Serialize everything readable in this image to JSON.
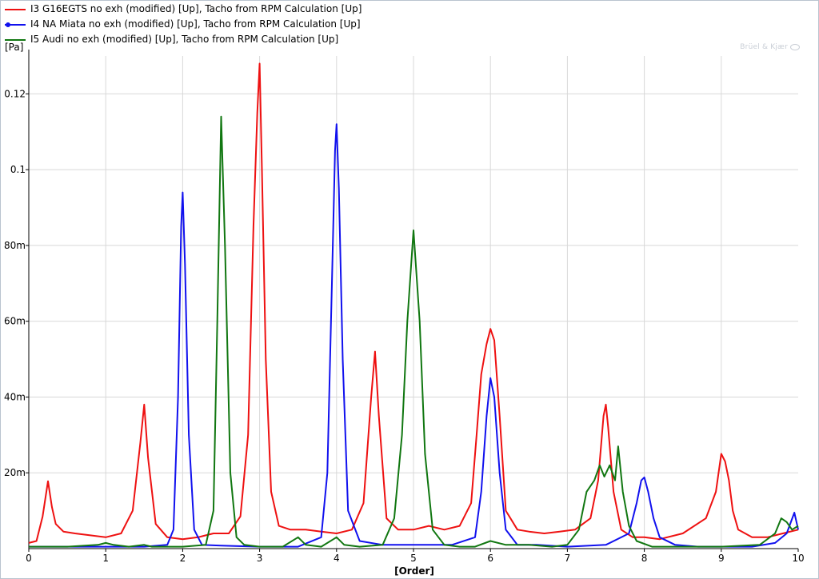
{
  "legend": {
    "items": [
      {
        "label": "I3 G16EGTS no exh (modified) [Up], Tacho from RPM Calculation [Up]",
        "color": "#ee1111",
        "marker": false
      },
      {
        "label": "I4 NA Miata no exh (modified) [Up], Tacho from RPM Calculation [Up]",
        "color": "#1111ee",
        "marker": true
      },
      {
        "label": "I5 Audi no exh (modified) [Up], Tacho from RPM Calculation [Up]",
        "color": "#117711",
        "marker": false
      }
    ]
  },
  "brand": "Brüel & Kjær",
  "chart_data": {
    "type": "line",
    "title": "",
    "xlabel": "[Order]",
    "ylabel": "[Pa]",
    "xlim": [
      0,
      10
    ],
    "ylim": [
      0,
      0.13
    ],
    "grid": true,
    "legend_position": "top-left",
    "x_ticks": [
      {
        "value": 0,
        "label": "0"
      },
      {
        "value": 1,
        "label": "1"
      },
      {
        "value": 2,
        "label": "2"
      },
      {
        "value": 3,
        "label": "3"
      },
      {
        "value": 4,
        "label": "4"
      },
      {
        "value": 5,
        "label": "5"
      },
      {
        "value": 6,
        "label": "6"
      },
      {
        "value": 7,
        "label": "7"
      },
      {
        "value": 8,
        "label": "8"
      },
      {
        "value": 9,
        "label": "9"
      },
      {
        "value": 10,
        "label": "10"
      }
    ],
    "y_ticks": [
      {
        "value": 0.02,
        "label": "20m"
      },
      {
        "value": 0.04,
        "label": "40m"
      },
      {
        "value": 0.06,
        "label": "60m"
      },
      {
        "value": 0.08,
        "label": "80m"
      },
      {
        "value": 0.1,
        "label": "0.1"
      },
      {
        "value": 0.12,
        "label": "0.12"
      }
    ],
    "series": [
      {
        "name": "I3 G16EGTS no exh (modified) [Up], Tacho from RPM Calculation [Up]",
        "color": "#ee1111",
        "x": [
          0,
          0.1,
          0.18,
          0.25,
          0.3,
          0.35,
          0.45,
          0.6,
          0.8,
          1.0,
          1.2,
          1.35,
          1.45,
          1.5,
          1.55,
          1.65,
          1.8,
          2.0,
          2.2,
          2.4,
          2.6,
          2.75,
          2.85,
          2.92,
          2.97,
          3.0,
          3.03,
          3.08,
          3.15,
          3.25,
          3.4,
          3.6,
          3.8,
          4.0,
          4.2,
          4.35,
          4.45,
          4.5,
          4.55,
          4.65,
          4.8,
          5.0,
          5.2,
          5.4,
          5.6,
          5.75,
          5.82,
          5.88,
          5.95,
          6.0,
          6.05,
          6.12,
          6.2,
          6.35,
          6.5,
          6.7,
          6.9,
          7.1,
          7.3,
          7.4,
          7.47,
          7.5,
          7.53,
          7.6,
          7.7,
          7.85,
          8.0,
          8.2,
          8.5,
          8.8,
          8.93,
          9.0,
          9.05,
          9.1,
          9.15,
          9.22,
          9.4,
          9.6,
          9.8,
          10.0
        ],
        "y": [
          0.0015,
          0.002,
          0.0085,
          0.0178,
          0.011,
          0.0065,
          0.0045,
          0.004,
          0.0035,
          0.003,
          0.004,
          0.01,
          0.028,
          0.038,
          0.024,
          0.0065,
          0.003,
          0.0025,
          0.003,
          0.004,
          0.004,
          0.0085,
          0.03,
          0.085,
          0.115,
          0.128,
          0.1,
          0.05,
          0.015,
          0.006,
          0.005,
          0.005,
          0.0045,
          0.004,
          0.005,
          0.012,
          0.04,
          0.052,
          0.035,
          0.008,
          0.005,
          0.005,
          0.006,
          0.005,
          0.006,
          0.012,
          0.03,
          0.046,
          0.054,
          0.058,
          0.055,
          0.035,
          0.01,
          0.005,
          0.0045,
          0.004,
          0.0045,
          0.005,
          0.008,
          0.018,
          0.035,
          0.038,
          0.032,
          0.015,
          0.005,
          0.003,
          0.003,
          0.0025,
          0.004,
          0.008,
          0.015,
          0.025,
          0.023,
          0.018,
          0.01,
          0.005,
          0.003,
          0.003,
          0.004,
          0.005
        ]
      },
      {
        "name": "I4 NA Miata no exh (modified) [Up], Tacho from RPM Calculation [Up]",
        "color": "#1111ee",
        "x": [
          0,
          0.5,
          1.0,
          1.5,
          1.8,
          1.88,
          1.94,
          1.98,
          2.0,
          2.03,
          2.08,
          2.15,
          2.25,
          2.5,
          3.0,
          3.5,
          3.8,
          3.88,
          3.94,
          3.98,
          4.0,
          4.03,
          4.08,
          4.15,
          4.3,
          4.6,
          5.0,
          5.5,
          5.8,
          5.88,
          5.95,
          6.0,
          6.05,
          6.12,
          6.2,
          6.35,
          6.6,
          7.0,
          7.5,
          7.8,
          7.9,
          7.96,
          8.0,
          8.05,
          8.12,
          8.2,
          8.4,
          8.7,
          9.0,
          9.4,
          9.7,
          9.85,
          9.95,
          10.0
        ],
        "y": [
          0.0005,
          0.0005,
          0.0005,
          0.0005,
          0.001,
          0.005,
          0.04,
          0.085,
          0.094,
          0.075,
          0.03,
          0.005,
          0.001,
          0.0008,
          0.0005,
          0.0005,
          0.003,
          0.02,
          0.07,
          0.105,
          0.112,
          0.095,
          0.05,
          0.01,
          0.002,
          0.001,
          0.001,
          0.001,
          0.003,
          0.015,
          0.035,
          0.045,
          0.04,
          0.02,
          0.005,
          0.001,
          0.001,
          0.0005,
          0.001,
          0.004,
          0.012,
          0.018,
          0.0188,
          0.015,
          0.008,
          0.003,
          0.001,
          0.0005,
          0.0005,
          0.0005,
          0.0015,
          0.004,
          0.0095,
          0.005
        ]
      },
      {
        "name": "I5 Audi no exh (modified) [Up], Tacho from RPM Calculation [Up]",
        "color": "#117711",
        "x": [
          0,
          0.5,
          0.9,
          1.0,
          1.1,
          1.3,
          1.5,
          1.6,
          2.0,
          2.3,
          2.4,
          2.45,
          2.5,
          2.55,
          2.62,
          2.7,
          2.8,
          3.0,
          3.3,
          3.5,
          3.6,
          3.8,
          4.0,
          4.1,
          4.3,
          4.6,
          4.75,
          4.85,
          4.92,
          5.0,
          5.08,
          5.15,
          5.25,
          5.4,
          5.6,
          5.8,
          6.0,
          6.2,
          6.5,
          6.8,
          7.0,
          7.15,
          7.25,
          7.35,
          7.42,
          7.48,
          7.55,
          7.62,
          7.66,
          7.72,
          7.8,
          7.9,
          8.1,
          8.5,
          9.0,
          9.5,
          9.7,
          9.78,
          9.85,
          9.92,
          10.0
        ],
        "y": [
          0.0005,
          0.0005,
          0.001,
          0.0015,
          0.001,
          0.0005,
          0.001,
          0.0005,
          0.0005,
          0.001,
          0.01,
          0.06,
          0.114,
          0.08,
          0.02,
          0.003,
          0.001,
          0.0005,
          0.0005,
          0.003,
          0.001,
          0.0005,
          0.003,
          0.001,
          0.0005,
          0.001,
          0.008,
          0.03,
          0.06,
          0.084,
          0.06,
          0.025,
          0.005,
          0.001,
          0.0005,
          0.0005,
          0.002,
          0.001,
          0.001,
          0.0005,
          0.001,
          0.005,
          0.015,
          0.018,
          0.022,
          0.019,
          0.022,
          0.018,
          0.027,
          0.015,
          0.006,
          0.002,
          0.0005,
          0.0005,
          0.0005,
          0.001,
          0.004,
          0.008,
          0.007,
          0.005,
          0.006
        ]
      }
    ]
  }
}
